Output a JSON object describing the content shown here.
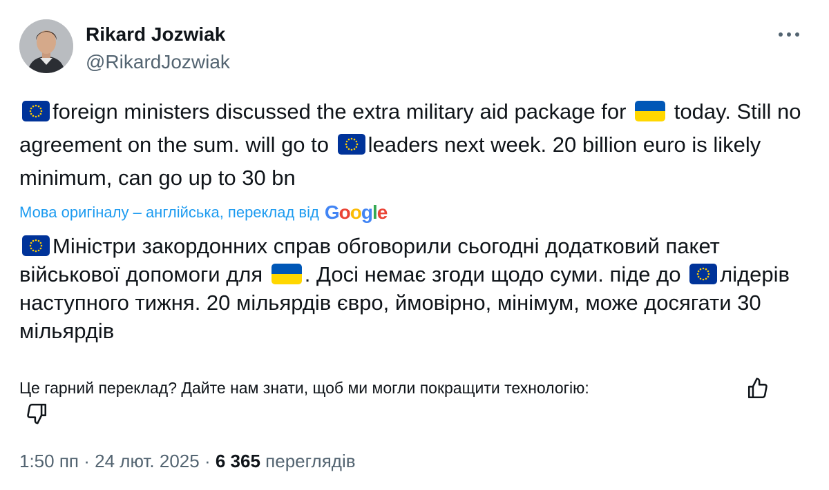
{
  "author": {
    "name": "Rikard Jozwiak",
    "handle": "@RikardJozwiak"
  },
  "icons": {
    "more": "more-horizontal-icon",
    "eu_flag": "eu-flag-icon",
    "ua_flag": "ukraine-flag-icon",
    "thumb_up": "thumbs-up-icon",
    "thumb_down": "thumbs-down-icon"
  },
  "tweet": {
    "original": {
      "s1": "foreign ministers discussed the extra military aid package for",
      "s2": "today. Still no agreement on the sum. will go to",
      "s3": "leaders next week. 20 billion euro is likely minimum, can go up to 30 bn"
    },
    "translation_notice": "Мова оригіналу – англійська, переклад від",
    "translation_provider": "Google",
    "translated": {
      "s1": "Міністри закордонних справ обговорили сьогодні додатковий пакет військової допомоги для",
      "s2": ". Досі немає згоди щодо суми. піде до",
      "s3": "лідерів наступного тижня. 20 мільярдів євро, ймовірно, мінімум, може досягати 30 мільярдів"
    },
    "feedback_prompt": "Це гарний переклад? Дайте нам знати, щоб ми могли покращити технологію:"
  },
  "meta": {
    "time": "1:50 пп",
    "date": "24 лют. 2025",
    "separator": "·",
    "views_count": "6 365",
    "views_label": "переглядів"
  },
  "colors": {
    "link_blue": "#1d9bf0",
    "secondary_text": "#536471",
    "primary_text": "#0f1419",
    "eu_blue": "#003399",
    "eu_star": "#ffcc00",
    "ua_blue": "#0057b7",
    "ua_yellow": "#ffd700"
  }
}
